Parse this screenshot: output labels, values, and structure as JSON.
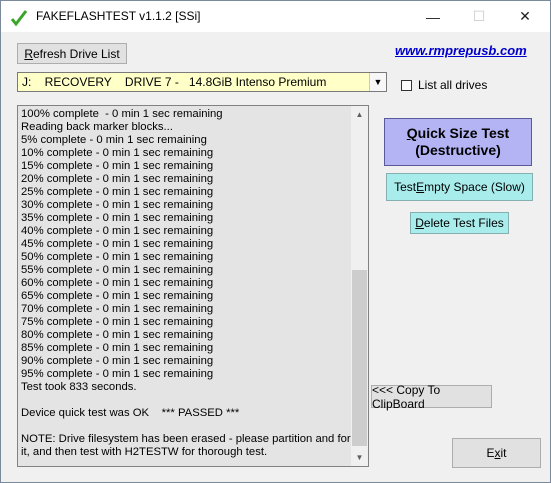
{
  "window": {
    "title": "FAKEFLASHTEST v1.1.2  [SSi]"
  },
  "titlebar": {
    "minimize": "—",
    "maximize": "☐",
    "close": "✕"
  },
  "toolbar": {
    "refresh_prefix": "R",
    "refresh_rest": "efresh Drive List",
    "website": "www.rmprepusb.com"
  },
  "drive": {
    "selected": "J:    RECOVERY    DRIVE 7 -   14.8GiB Intenso Premium",
    "list_all_label": "List all drives",
    "list_all_checked": false
  },
  "log": {
    "lines": [
      "100% complete  - 0 min 1 sec remaining",
      "Reading back marker blocks...",
      "5% complete - 0 min 1 sec remaining",
      "10% complete - 0 min 1 sec remaining",
      "15% complete - 0 min 1 sec remaining",
      "20% complete - 0 min 1 sec remaining",
      "25% complete - 0 min 1 sec remaining",
      "30% complete - 0 min 1 sec remaining",
      "35% complete - 0 min 1 sec remaining",
      "40% complete - 0 min 1 sec remaining",
      "45% complete - 0 min 1 sec remaining",
      "50% complete - 0 min 1 sec remaining",
      "55% complete - 0 min 1 sec remaining",
      "60% complete - 0 min 1 sec remaining",
      "65% complete - 0 min 1 sec remaining",
      "70% complete - 0 min 1 sec remaining",
      "75% complete - 0 min 1 sec remaining",
      "80% complete - 0 min 1 sec remaining",
      "85% complete - 0 min 1 sec remaining",
      "90% complete - 0 min 1 sec remaining",
      "95% complete - 0 min 1 sec remaining",
      "Test took 833 seconds.",
      "",
      "Device quick test was OK    *** PASSED ***",
      "",
      "NOTE: Drive filesystem has been erased - please partition and format",
      "it, and then test with H2TESTW for thorough test."
    ]
  },
  "actions": {
    "quick_prefix": "Q",
    "quick_rest": "uick Size Test",
    "quick_line2": "(Destructive)",
    "empty_pre": "Test ",
    "empty_u": "E",
    "empty_rest": "mpty Space (Slow)",
    "delete_u": "D",
    "delete_rest": "elete Test Files",
    "copy": "<<< Copy To ClipBoard",
    "exit_pre": "E",
    "exit_u": "x",
    "exit_rest": "it"
  },
  "colors": {
    "quick_bg": "#b4b4f5",
    "cyan_btn": "#a9ecec",
    "select_bg": "#ffffc8",
    "link": "#0000cc",
    "check_green": "#3aa629"
  }
}
